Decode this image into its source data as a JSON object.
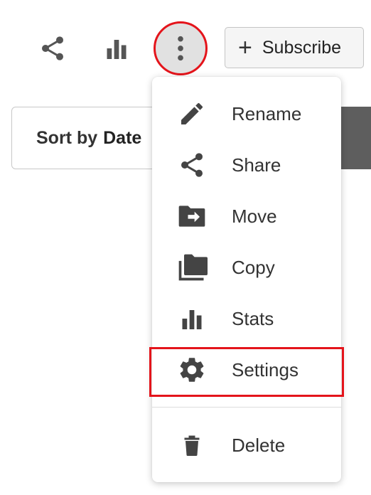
{
  "toolbar": {
    "share_icon": "share-icon",
    "stats_icon": "bar-chart-icon",
    "more_icon": "more-vertical-icon",
    "subscribe_icon": "plus-icon",
    "subscribe_label": "Subscribe"
  },
  "sort": {
    "prefix": "Sort by",
    "value": "Date"
  },
  "menu": {
    "items": [
      {
        "icon": "pencil-icon",
        "label": "Rename"
      },
      {
        "icon": "share-icon",
        "label": "Share"
      },
      {
        "icon": "folder-move-icon",
        "label": "Move"
      },
      {
        "icon": "copy-folders-icon",
        "label": "Copy"
      },
      {
        "icon": "bar-chart-icon",
        "label": "Stats"
      },
      {
        "icon": "gear-icon",
        "label": "Settings"
      },
      {
        "icon": "trash-icon",
        "label": "Delete"
      }
    ]
  },
  "colors": {
    "highlight": "#e4141b",
    "icon": "#444444",
    "text": "#333333"
  }
}
